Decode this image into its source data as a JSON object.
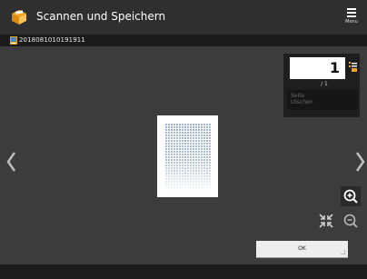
{
  "header": {
    "title": "Scannen und Speichern",
    "menu_label": "Menu",
    "app_icon": "scan-and-store-icon"
  },
  "document": {
    "id": "2018081010191911"
  },
  "pager": {
    "current_page": "1",
    "page_count": "/ 1",
    "delete_label": "Seite\nLöschen"
  },
  "controls": {
    "ok_label": "OK"
  },
  "colors": {
    "header_bg": "#2f2f2f",
    "main_bg": "#3c3c3c",
    "accent_orange": "#f4a623",
    "preview_blue": "#9fb6cf"
  }
}
